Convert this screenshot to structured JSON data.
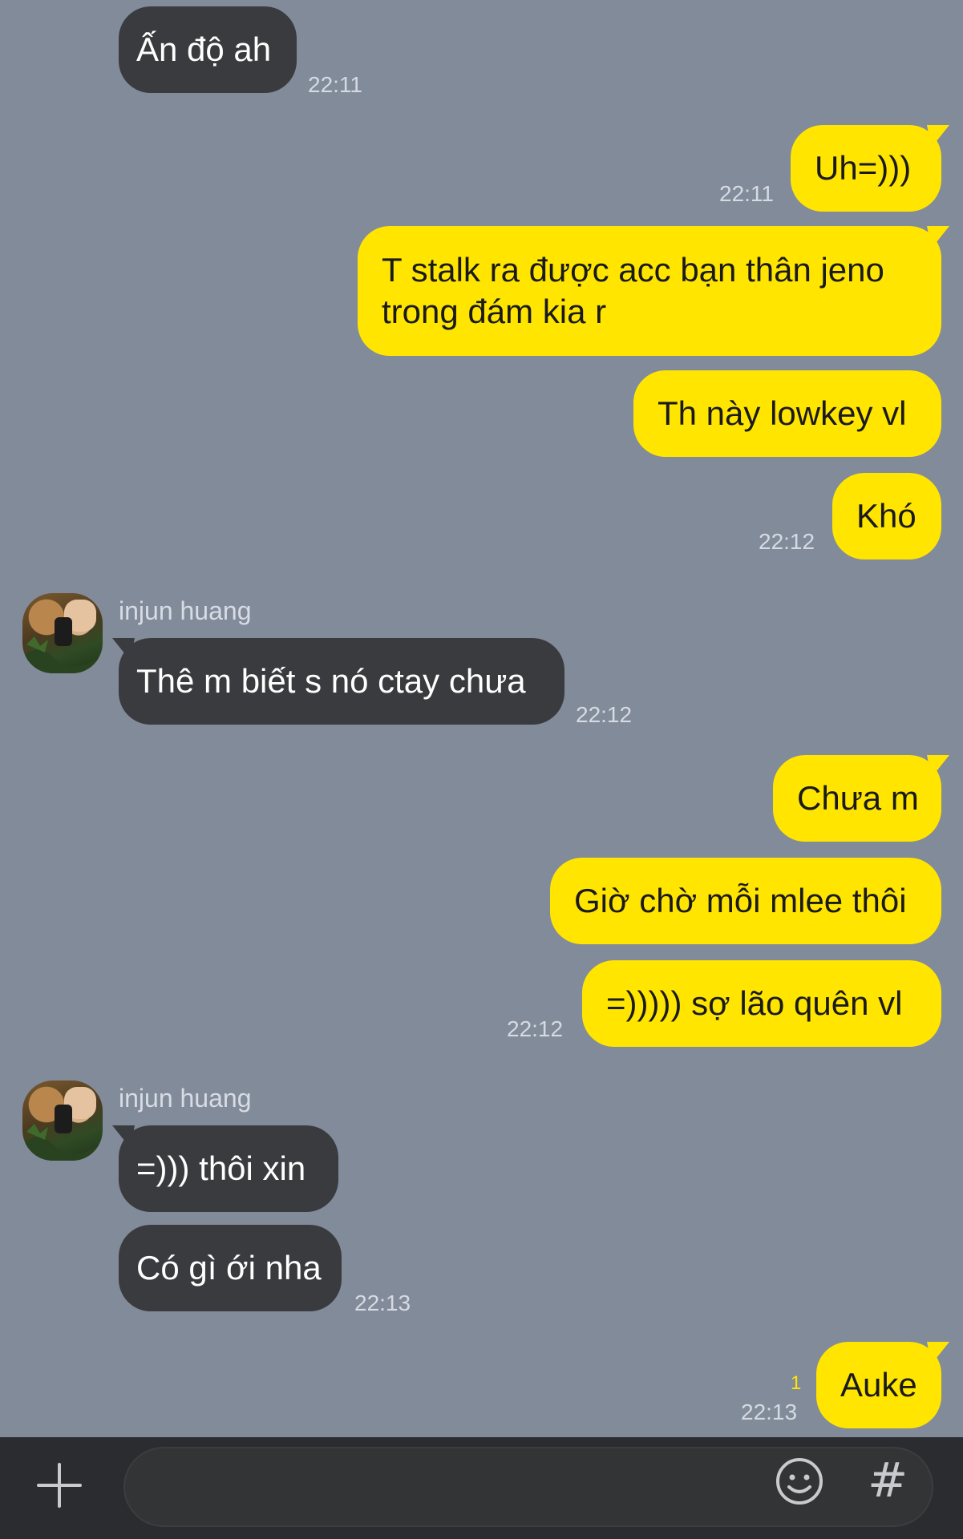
{
  "contact": {
    "name": "injun huang"
  },
  "messages": [
    {
      "id": 1,
      "side": "in",
      "text": "Ấn độ ah",
      "time": "22:11"
    },
    {
      "id": 2,
      "side": "out",
      "text": "Uh=)))",
      "time": "22:11"
    },
    {
      "id": 3,
      "side": "out",
      "text": "T stalk ra được acc bạn thân jeno trong đám kia r"
    },
    {
      "id": 4,
      "side": "out",
      "text": "Th này lowkey vl"
    },
    {
      "id": 5,
      "side": "out",
      "text": "Khó",
      "time": "22:12"
    },
    {
      "id": 6,
      "side": "in",
      "sender": "injun huang",
      "text": "Thê m biết s nó ctay chưa",
      "time": "22:12"
    },
    {
      "id": 7,
      "side": "out",
      "text": "Chưa m"
    },
    {
      "id": 8,
      "side": "out",
      "text": "Giờ chờ mỗi mlee thôi"
    },
    {
      "id": 9,
      "side": "out",
      "text": "=))))) sợ lão quên vl",
      "time": "22:12"
    },
    {
      "id": 10,
      "side": "in",
      "sender": "injun huang",
      "text": "=))) thôi xin"
    },
    {
      "id": 11,
      "side": "in",
      "text": "Có gì ới nha",
      "time": "22:13"
    },
    {
      "id": 12,
      "side": "out",
      "text": "Auke",
      "time": "22:13",
      "unread_count": "1"
    }
  ],
  "input_bar": {
    "placeholder": "",
    "plus_icon": "plus-icon",
    "emoji_icon": "emoji-icon",
    "hash_label": "#"
  },
  "colors": {
    "background": "#828b9a",
    "incoming_bubble": "#3a3b3e",
    "outgoing_bubble": "#ffe500",
    "input_bar": "#2b2c2f"
  }
}
